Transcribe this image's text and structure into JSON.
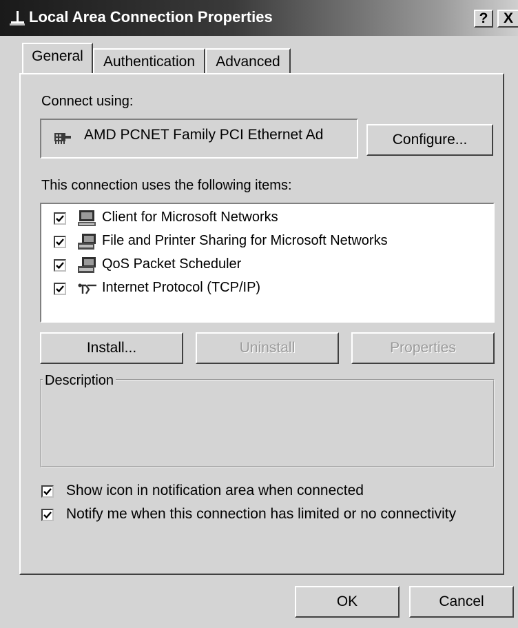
{
  "window": {
    "title": "Local Area Connection Properties",
    "help_label": "?",
    "close_label": "X"
  },
  "tabs": [
    {
      "label": "General",
      "active": true
    },
    {
      "label": "Authentication",
      "active": false
    },
    {
      "label": "Advanced",
      "active": false
    }
  ],
  "general": {
    "connect_using_label": "Connect using:",
    "adapter_name": "AMD PCNET Family PCI Ethernet Ad",
    "adapter_icon": "network-card-icon",
    "configure_label": "Configure...",
    "items_label": "This connection uses the following items:",
    "items": [
      {
        "label": "Client for Microsoft Networks",
        "checked": true,
        "icon": "computer-client-icon"
      },
      {
        "label": "File and Printer Sharing for Microsoft Networks",
        "checked": true,
        "icon": "computer-service-icon"
      },
      {
        "label": "QoS Packet Scheduler",
        "checked": true,
        "icon": "computer-service-icon"
      },
      {
        "label": "Internet Protocol (TCP/IP)",
        "checked": true,
        "icon": "network-protocol-icon"
      }
    ],
    "install_label": "Install...",
    "uninstall_label": "Uninstall",
    "properties_label": "Properties",
    "description_label": "Description",
    "description_text": "",
    "options": [
      {
        "label": "Show icon in notification area when connected",
        "checked": true
      },
      {
        "label": "Notify me when this connection has limited or no connectivity",
        "checked": true
      }
    ]
  },
  "footer": {
    "ok_label": "OK",
    "cancel_label": "Cancel"
  },
  "colors": {
    "face": "#d4d4d4",
    "titlebar_dark": "#1a1a1a",
    "disabled_text": "#9a9a9a"
  }
}
